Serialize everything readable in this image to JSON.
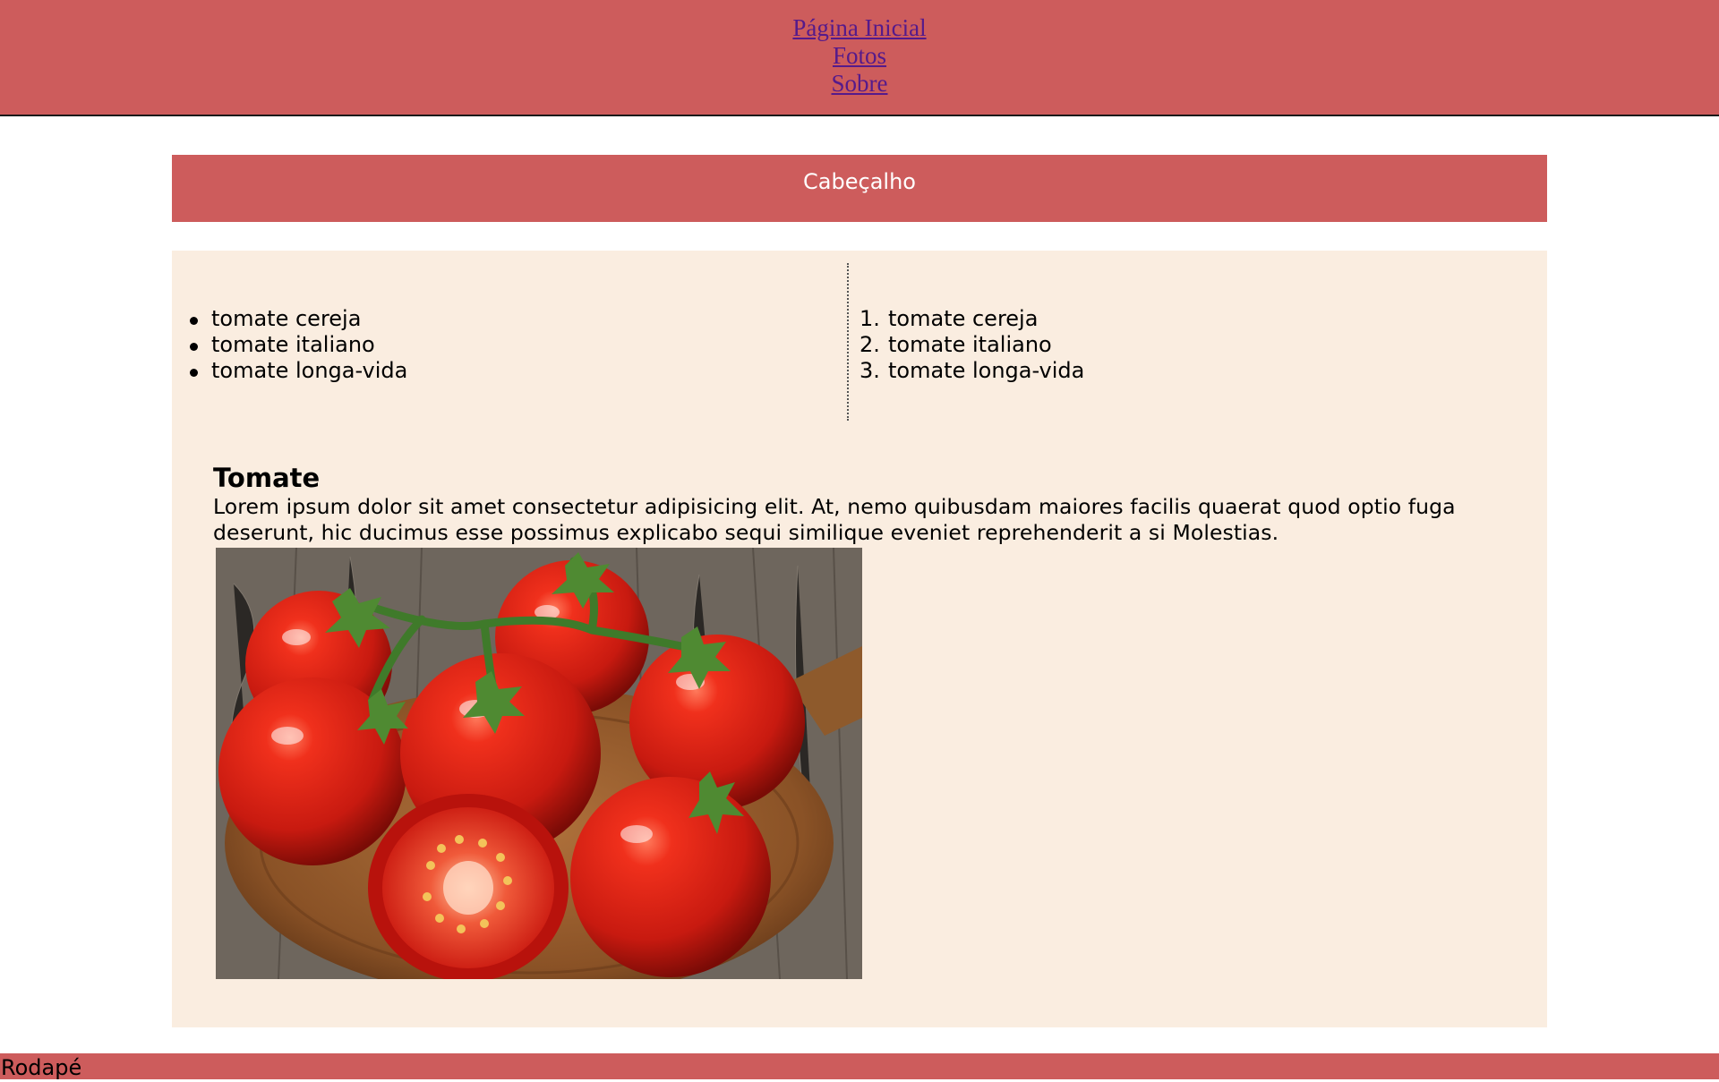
{
  "nav": {
    "links": [
      "Página Inicial",
      "Fotos",
      "Sobre"
    ]
  },
  "header": {
    "title": "Cabeçalho"
  },
  "lists": {
    "unordered": [
      "tomate cereja",
      "tomate italiano",
      "tomate longa-vida"
    ],
    "ordered": [
      "tomate cereja",
      "tomate italiano",
      "tomate longa-vida"
    ],
    "ordered_markers": [
      "1.",
      "2.",
      "3."
    ]
  },
  "article": {
    "title": "Tomate",
    "text": "Lorem ipsum dolor sit amet consectetur adipisicing elit. At, nemo quibusdam maiores facilis quaerat quod optio fuga deserunt, hic ducimus esse possimus explicabo sequi similique eveniet reprehenderit a si Molestias."
  },
  "footer": {
    "text": "Rodapé"
  },
  "colors": {
    "accent": "#cd5c5c",
    "content_bg": "#faede0",
    "link": "#551a8b"
  }
}
